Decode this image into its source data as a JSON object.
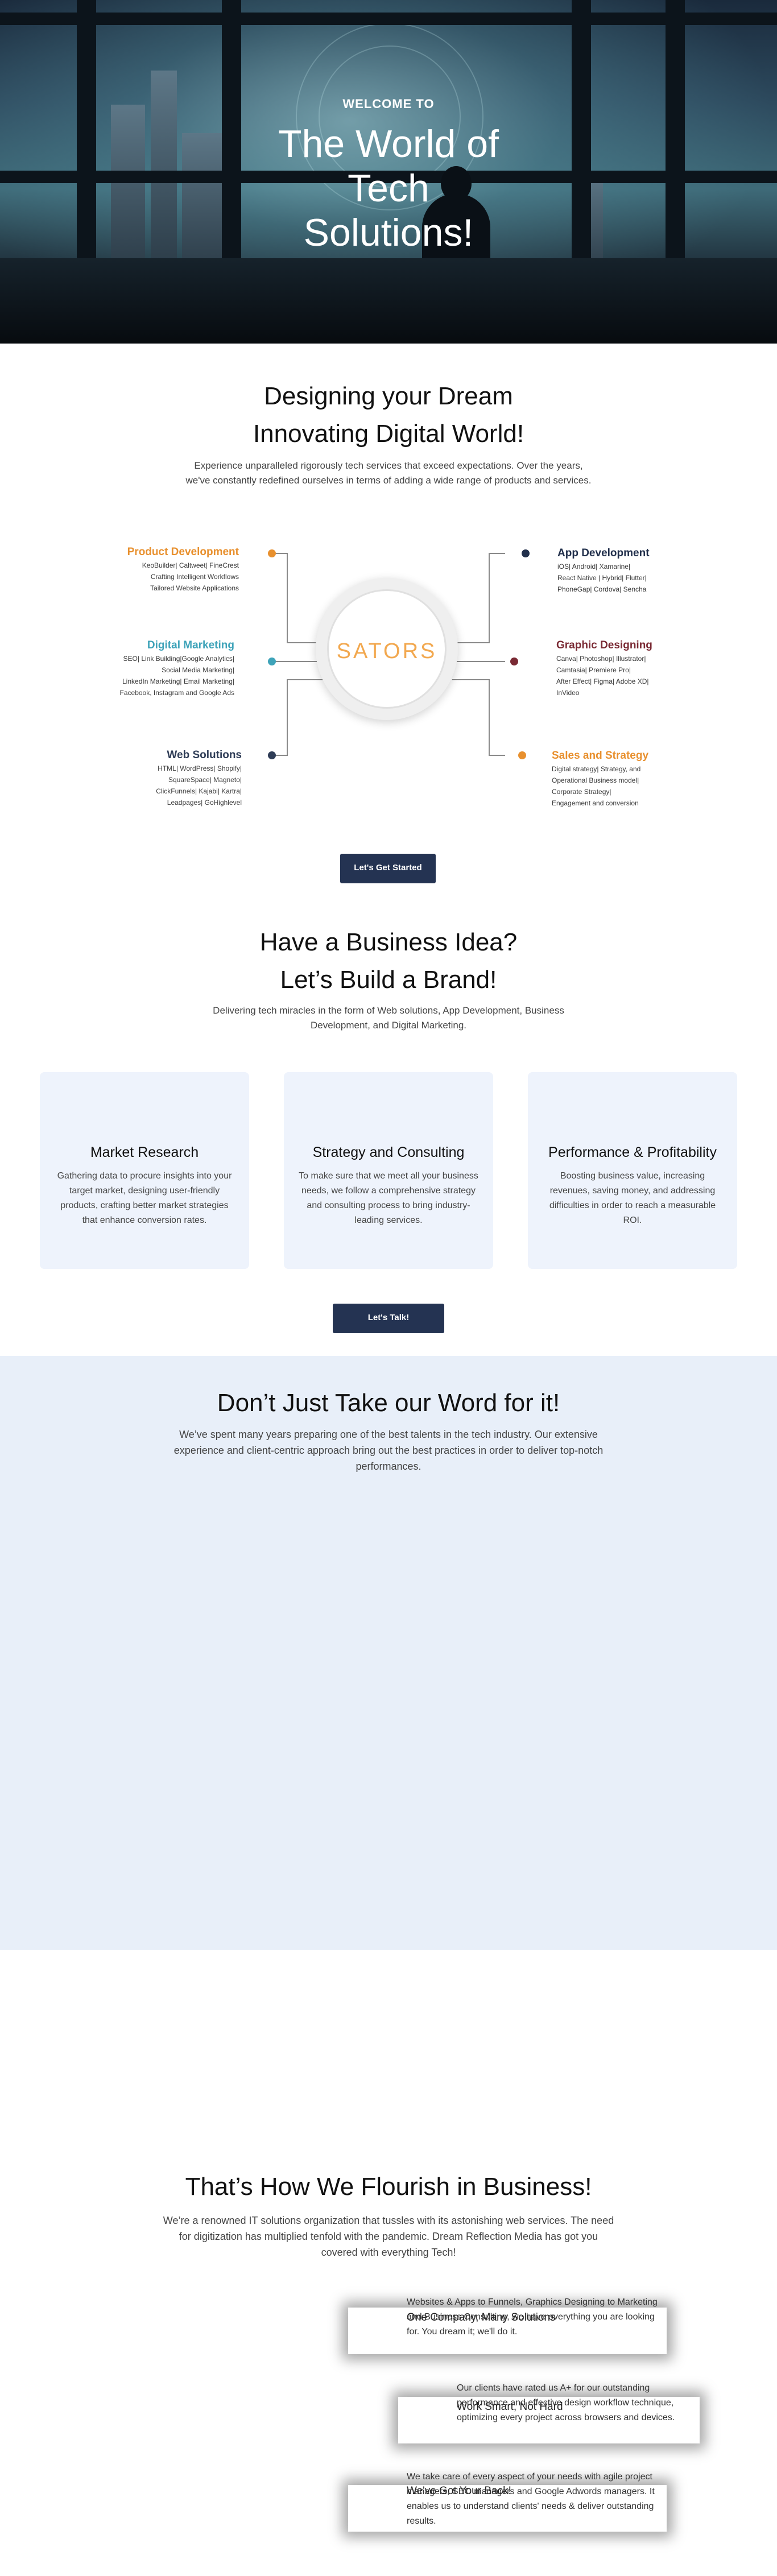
{
  "hero": {
    "kicker": "WELCOME TO",
    "title_lines": [
      "The World of",
      "Tech",
      "Solutions!"
    ]
  },
  "dream": {
    "heading_lines": [
      "Designing your Dream",
      "Innovating Digital World!"
    ],
    "lead": "Experience unparalleled rigorously tech services that exceed expectations. Over the years, we've constantly redefined ourselves in terms of adding a wide range of products and services.",
    "logo": "SATORS",
    "services": [
      {
        "title": "Product Development",
        "color": "#e8902e",
        "lines": [
          "KeoBuilder| Caltweet| FineCrest",
          "Crafting Intelligent Workflows",
          "Tailored Website Applications"
        ]
      },
      {
        "title": "Digital Marketing",
        "color": "#3ea3b9",
        "lines": [
          "SEO| Link Building|Google Analytics|",
          "Social Media Marketing|",
          "LinkedIn Marketing| Email Marketing|",
          "Facebook, Instagram and Google Ads"
        ]
      },
      {
        "title": "Web Solutions",
        "color": "#2e3c56",
        "lines": [
          "HTML| WordPress| Shopify|",
          "SquareSpace| Magneto|",
          "ClickFunnels| Kajabi| Kartra|",
          "Leadpages| GoHighlevel"
        ]
      },
      {
        "title": "App Development",
        "color": "#22304c",
        "lines": [
          "iOS| Android| Xamarine|",
          "React Native | Hybrid| Flutter|",
          "PhoneGap| Cordova| Sencha"
        ]
      },
      {
        "title": "Graphic Designing",
        "color": "#7a2a34",
        "lines": [
          "Canva| Photoshop| Illustrator|",
          "Camtasia| Premiere Pro|",
          "After Effect| Figma| Adobe XD|",
          "InVideo"
        ]
      },
      {
        "title": "Sales and Strategy",
        "color": "#e8902e",
        "lines": [
          "Digital strategy| Strategy, and",
          "Operational Business model|",
          "Corporate Strategy|",
          "Engagement and conversion"
        ]
      }
    ],
    "cta": "Let's Get Started"
  },
  "brand": {
    "heading_lines": [
      "Have a Business Idea?",
      "Let’s Build a Brand!"
    ],
    "lead": "Delivering tech miracles in the form of Web solutions, App Development, Business Development, and Digital Marketing.",
    "cards": [
      {
        "title": "Market Research",
        "text": "Gathering data to procure insights into your target market, designing user-friendly products, crafting better market strategies that enhance conversion rates."
      },
      {
        "title": "Strategy and Consulting",
        "text": "To make sure that we meet all your business needs, we follow a comprehensive strategy and consulting process to bring industry-leading services."
      },
      {
        "title": "Performance & Profitability",
        "text": "Boosting business value, increasing revenues, saving money, and addressing difficulties in order to reach a measurable ROI."
      }
    ],
    "cta": "Let's Talk!"
  },
  "testimonials": {
    "heading": "Don’t Just Take our Word for it!",
    "lead": "We’ve spent many years preparing one of the best talents in the tech industry. Our extensive experience and client-centric approach bring out the best practices in order to deliver top-notch performances."
  },
  "flourish": {
    "heading": "That’s How We Flourish in Business!",
    "lead": "We’re a renowned IT solutions organization that tussles with its astonishing web services. The need for digitization has multiplied tenfold with the pandemic. Dream Reflection Media has got you covered with everything Tech!",
    "items": [
      {
        "title": "One Company, Many Solutions",
        "text": "Websites & Apps to Funnels, Graphics Designing to Marketing and Business Consulting, we have everything you are looking for. You dream it; we'll do it."
      },
      {
        "title": "Work Smart, Not Hard",
        "text": "Our clients have rated us A+ for our outstanding performance and effective design workflow technique, optimizing every project across browsers and devices."
      },
      {
        "title": "We've Got Your Back!",
        "text": "We take care of every aspect of your needs with agile project managers, SEO managers and Google Adwords managers. It enables us to understand clients' needs & deliver outstanding results."
      }
    ]
  }
}
